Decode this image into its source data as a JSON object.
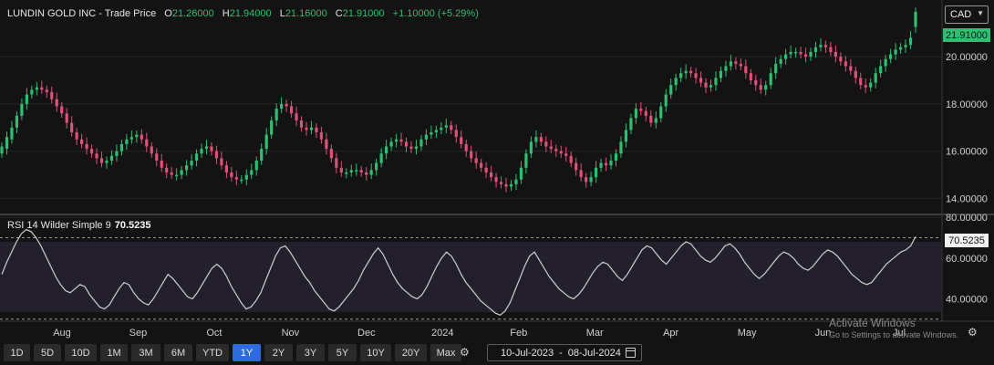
{
  "header": {
    "title": "LUNDIN GOLD INC - Trade Price",
    "o_label": "O",
    "o_value": "21.26000",
    "h_label": "H",
    "h_value": "21.94000",
    "l_label": "L",
    "l_value": "21.16000",
    "c_label": "C",
    "c_value": "21.91000",
    "change": "+1.10000 (+5.29%)"
  },
  "currency_select": "CAD",
  "rsi_legend": {
    "label": "RSI 14 Wilder Simple 9",
    "value": "70.5235"
  },
  "timeframes": [
    "1D",
    "5D",
    "10D",
    "1M",
    "3M",
    "6M",
    "YTD",
    "1Y",
    "2Y",
    "3Y",
    "5Y",
    "10Y",
    "20Y",
    "Max"
  ],
  "active_timeframe": "1Y",
  "date_range": {
    "from": "10-Jul-2023",
    "sep": "-",
    "to": "08-Jul-2024"
  },
  "watermark": {
    "line1": "Activate Windows",
    "line2": "Go to Settings to activate Windows."
  },
  "icons": [
    "gear-icon",
    "calendar-icon",
    "chevron-down-icon"
  ],
  "colors": {
    "up": "#2fbf71",
    "down": "#e0507a",
    "rsi": "#d0d0d0",
    "rsi_band": "#231f2c",
    "active": "#2d6cdf"
  },
  "chart_data": [
    {
      "type": "candlestick",
      "title": "LUNDIN GOLD INC - Trade Price",
      "y_ticks": [
        "14.00000",
        "16.00000",
        "18.00000",
        "20.00000"
      ],
      "ylim": [
        13.4,
        22.4
      ],
      "last_price_label": "21.91000",
      "x_ticks": [
        "Aug",
        "Sep",
        "Oct",
        "Nov",
        "Dec",
        "2024",
        "Feb",
        "Mar",
        "Apr",
        "May",
        "Jun",
        "Jul"
      ],
      "close": [
        16.2,
        16.6,
        17.0,
        17.5,
        18.0,
        18.4,
        18.6,
        18.7,
        18.6,
        18.5,
        18.2,
        17.9,
        17.6,
        17.2,
        16.8,
        16.5,
        16.3,
        16.1,
        15.9,
        15.7,
        15.5,
        15.6,
        15.8,
        16.0,
        16.3,
        16.5,
        16.6,
        16.7,
        16.5,
        16.2,
        15.9,
        15.6,
        15.3,
        15.1,
        15.0,
        15.0,
        15.2,
        15.4,
        15.6,
        15.9,
        16.1,
        16.2,
        16.0,
        15.7,
        15.4,
        15.1,
        14.9,
        14.8,
        14.8,
        15.0,
        15.2,
        15.6,
        16.1,
        16.7,
        17.3,
        17.8,
        18.0,
        17.9,
        17.6,
        17.3,
        17.0,
        16.9,
        17.0,
        16.8,
        16.5,
        16.1,
        15.7,
        15.3,
        15.1,
        15.1,
        15.2,
        15.2,
        15.1,
        15.0,
        15.2,
        15.5,
        15.9,
        16.2,
        16.4,
        16.5,
        16.4,
        16.2,
        16.1,
        16.2,
        16.5,
        16.7,
        16.8,
        16.9,
        17.0,
        17.1,
        16.9,
        16.6,
        16.3,
        16.0,
        15.7,
        15.5,
        15.3,
        15.1,
        14.9,
        14.7,
        14.6,
        14.5,
        14.6,
        14.8,
        15.3,
        15.9,
        16.4,
        16.6,
        16.4,
        16.2,
        16.1,
        16.0,
        15.9,
        15.8,
        15.5,
        15.2,
        14.9,
        14.7,
        14.9,
        15.3,
        15.5,
        15.4,
        15.6,
        15.9,
        16.4,
        16.9,
        17.4,
        17.8,
        17.7,
        17.5,
        17.2,
        17.4,
        17.9,
        18.4,
        18.8,
        19.1,
        19.3,
        19.4,
        19.3,
        19.1,
        18.9,
        18.7,
        18.8,
        19.1,
        19.4,
        19.6,
        19.8,
        19.7,
        19.6,
        19.3,
        19.0,
        18.8,
        18.6,
        18.8,
        19.3,
        19.7,
        19.9,
        20.1,
        20.2,
        20.2,
        20.1,
        20.0,
        20.2,
        20.4,
        20.5,
        20.4,
        20.2,
        20.0,
        19.8,
        19.6,
        19.4,
        19.1,
        18.8,
        18.7,
        18.9,
        19.3,
        19.6,
        19.9,
        20.1,
        20.3,
        20.4,
        20.5,
        20.8,
        21.9
      ],
      "open": [
        15.9,
        16.1,
        16.5,
        17.0,
        17.5,
        18.0,
        18.4,
        18.6,
        18.7,
        18.6,
        18.5,
        18.2,
        17.9,
        17.6,
        17.2,
        16.8,
        16.5,
        16.3,
        16.1,
        15.9,
        15.7,
        15.5,
        15.6,
        15.8,
        16.0,
        16.3,
        16.5,
        16.6,
        16.7,
        16.5,
        16.2,
        15.9,
        15.6,
        15.3,
        15.1,
        15.0,
        15.0,
        15.2,
        15.4,
        15.6,
        15.9,
        16.1,
        16.2,
        16.0,
        15.7,
        15.4,
        15.1,
        14.9,
        14.8,
        14.8,
        15.0,
        15.2,
        15.6,
        16.1,
        16.7,
        17.3,
        17.8,
        18.0,
        17.9,
        17.6,
        17.3,
        17.0,
        16.9,
        17.0,
        16.8,
        16.5,
        16.1,
        15.7,
        15.3,
        15.1,
        15.1,
        15.2,
        15.2,
        15.1,
        15.0,
        15.2,
        15.5,
        15.9,
        16.2,
        16.4,
        16.5,
        16.4,
        16.2,
        16.1,
        16.2,
        16.5,
        16.7,
        16.8,
        16.9,
        17.0,
        17.1,
        16.9,
        16.6,
        16.3,
        16.0,
        15.7,
        15.5,
        15.3,
        15.1,
        14.9,
        14.7,
        14.6,
        14.5,
        14.6,
        14.8,
        15.3,
        15.9,
        16.4,
        16.6,
        16.4,
        16.2,
        16.1,
        16.0,
        15.9,
        15.8,
        15.5,
        15.2,
        14.9,
        14.7,
        14.9,
        15.3,
        15.5,
        15.4,
        15.6,
        15.9,
        16.4,
        16.9,
        17.4,
        17.8,
        17.7,
        17.5,
        17.2,
        17.4,
        17.9,
        18.4,
        18.8,
        19.1,
        19.3,
        19.4,
        19.3,
        19.1,
        18.9,
        18.7,
        18.8,
        19.1,
        19.4,
        19.6,
        19.8,
        19.7,
        19.6,
        19.3,
        19.0,
        18.8,
        18.6,
        18.8,
        19.3,
        19.7,
        19.9,
        20.1,
        20.2,
        20.2,
        20.1,
        20.0,
        20.2,
        20.4,
        20.5,
        20.4,
        20.2,
        20.0,
        19.8,
        19.6,
        19.4,
        19.1,
        18.8,
        18.7,
        18.9,
        19.3,
        19.6,
        19.9,
        20.1,
        20.3,
        20.4,
        20.5,
        21.26
      ]
    },
    {
      "type": "line",
      "title": "RSI 14 Wilder Simple 9",
      "y_ticks": [
        "40.00000",
        "60.00000",
        "80.00000"
      ],
      "ylim": [
        29,
        81
      ],
      "reference_lines": [
        30,
        70
      ],
      "last_value_label": "70.5235",
      "values": [
        52,
        58,
        63,
        68,
        72,
        74,
        73,
        70,
        66,
        61,
        56,
        51,
        47,
        44,
        43,
        45,
        47,
        46,
        42,
        39,
        36,
        35,
        37,
        41,
        45,
        48,
        47,
        43,
        40,
        38,
        37,
        40,
        44,
        48,
        52,
        50,
        47,
        44,
        41,
        40,
        43,
        47,
        51,
        55,
        57,
        55,
        51,
        46,
        42,
        38,
        35,
        36,
        39,
        43,
        49,
        55,
        61,
        65,
        66,
        63,
        59,
        55,
        51,
        48,
        44,
        41,
        38,
        35,
        34,
        36,
        39,
        42,
        45,
        49,
        54,
        58,
        62,
        65,
        62,
        57,
        52,
        48,
        45,
        43,
        41,
        40,
        42,
        46,
        51,
        56,
        60,
        63,
        61,
        57,
        52,
        48,
        45,
        42,
        39,
        37,
        35,
        33,
        32,
        34,
        38,
        44,
        50,
        56,
        61,
        63,
        59,
        55,
        51,
        48,
        45,
        43,
        41,
        40,
        42,
        45,
        49,
        53,
        56,
        58,
        57,
        54,
        51,
        49,
        52,
        56,
        60,
        64,
        66,
        65,
        62,
        59,
        57,
        60,
        63,
        66,
        68,
        67,
        64,
        61,
        59,
        58,
        60,
        63,
        66,
        67,
        65,
        62,
        58,
        55,
        52,
        50,
        52,
        55,
        58,
        61,
        63,
        62,
        60,
        57,
        55,
        54,
        56,
        59,
        62,
        64,
        63,
        61,
        58,
        55,
        52,
        50,
        48,
        47,
        48,
        51,
        54,
        57,
        59,
        61,
        63,
        64,
        66,
        70.52
      ]
    }
  ]
}
